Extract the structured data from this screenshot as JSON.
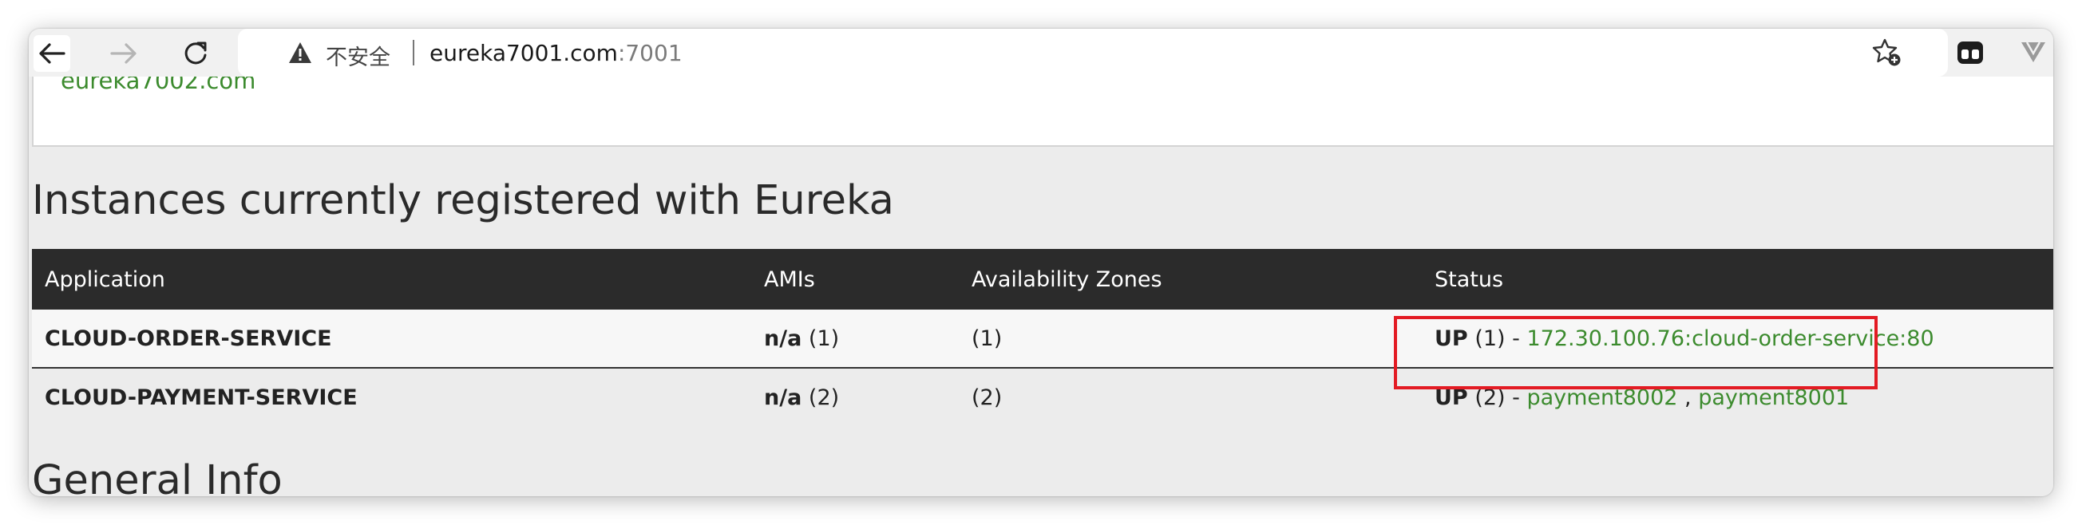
{
  "browser": {
    "insecure_label": "不安全",
    "url_host": "eureka7001.com",
    "url_port": ":7001",
    "icons": {
      "back": "back-arrow-icon",
      "forward": "forward-arrow-icon",
      "reload": "reload-icon",
      "warning": "warning-icon",
      "bookmark": "bookmark-star-icon",
      "extension": "extension-icon",
      "menu": "menu-chevron-icon"
    }
  },
  "page": {
    "previous_replica_link": "eureka7002.com",
    "instances_title": "Instances currently registered with Eureka",
    "general_info_title": "General Info",
    "table": {
      "headers": [
        "Application",
        "AMIs",
        "Availability Zones",
        "Status"
      ],
      "rows": [
        {
          "application": "CLOUD-ORDER-SERVICE",
          "ami_label": "n/a",
          "ami_count": "(1)",
          "zones": "(1)",
          "status": "UP",
          "status_count": "(1) - ",
          "instances": [
            "172.30.100.76:cloud-order-service:80"
          ]
        },
        {
          "application": "CLOUD-PAYMENT-SERVICE",
          "ami_label": "n/a",
          "ami_count": "(2)",
          "zones": "(2)",
          "status": "UP",
          "status_count": "(2) - ",
          "instances": [
            "payment8002",
            "payment8001"
          ],
          "instance_separator": " , "
        }
      ]
    }
  },
  "colors": {
    "link_green": "#3c8b2e",
    "table_header_bg": "#2b2b2b",
    "highlight_red": "#e31b23"
  }
}
